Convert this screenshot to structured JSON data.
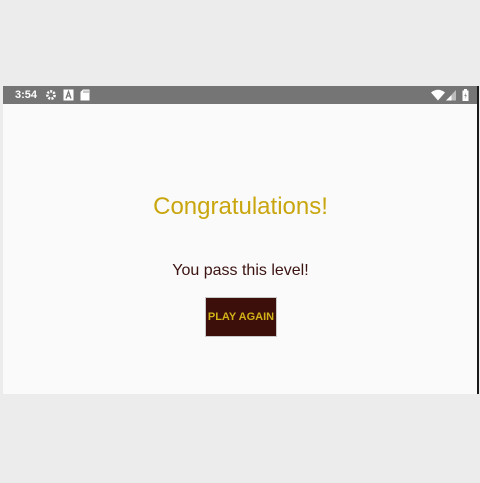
{
  "status_bar": {
    "time": "3:54",
    "left_icons": [
      "gear-icon",
      "a-icon",
      "sd-card-icon"
    ],
    "right_icons": [
      "wifi-icon",
      "signal-icon",
      "battery-icon"
    ],
    "background_color": "#757575"
  },
  "screen": {
    "title": "Congratulations!",
    "message": "You pass this level!",
    "button_label": "PLAY AGAIN"
  },
  "colors": {
    "accent": "#c9a60e",
    "button_background": "#3c0f0b",
    "message_text": "#3b1412"
  }
}
